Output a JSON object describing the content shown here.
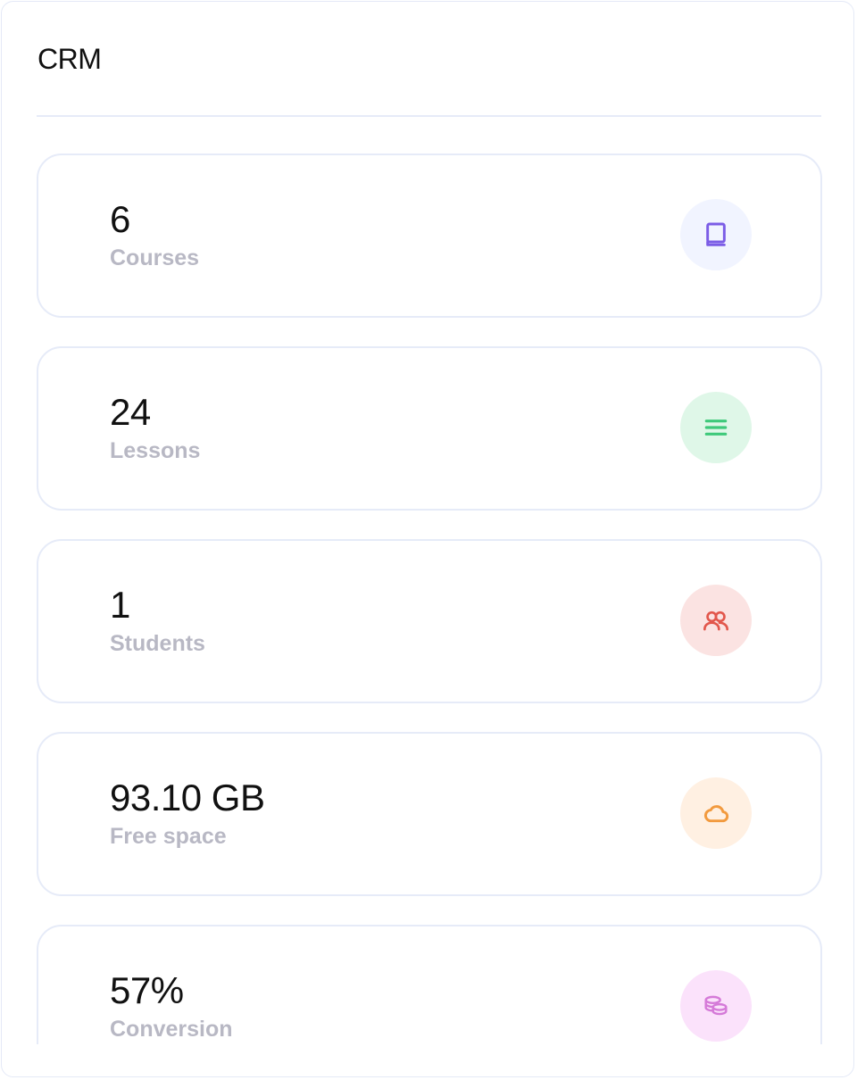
{
  "header": {
    "title": "CRM"
  },
  "stats": [
    {
      "value": "6",
      "label": "Courses",
      "icon": "book-icon",
      "icon_color": "#7b5ce6",
      "icon_bg": "#f1f4ff"
    },
    {
      "value": "24",
      "label": "Lessons",
      "icon": "list-icon",
      "icon_color": "#3ec97a",
      "icon_bg": "#dff7e8"
    },
    {
      "value": "1",
      "label": "Students",
      "icon": "users-icon",
      "icon_color": "#e2574c",
      "icon_bg": "#fbe3e2"
    },
    {
      "value": "93.10 GB",
      "label": "Free space",
      "icon": "cloud-icon",
      "icon_color": "#f29a3e",
      "icon_bg": "#fff0e2"
    },
    {
      "value": "57%",
      "label": "Conversion",
      "icon": "coins-icon",
      "icon_color": "#d57ad8",
      "icon_bg": "#fbe2fb"
    }
  ]
}
